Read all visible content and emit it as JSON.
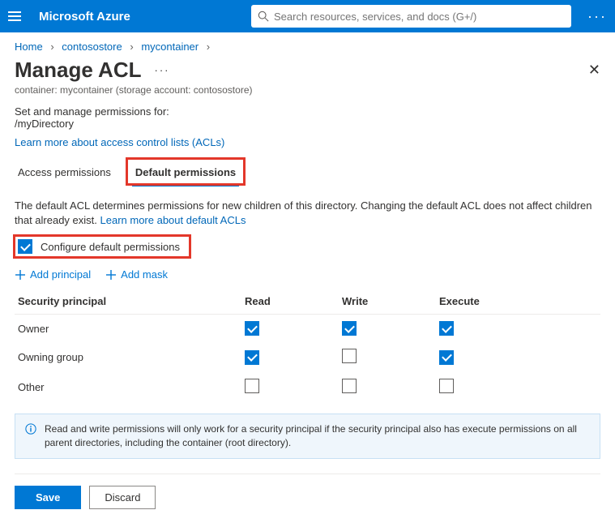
{
  "topbar": {
    "brand": "Microsoft Azure",
    "search_placeholder": "Search resources, services, and docs (G+/)"
  },
  "breadcrumb": {
    "items": [
      "Home",
      "contosostore",
      "mycontainer"
    ]
  },
  "header": {
    "title": "Manage ACL",
    "subtitle": "container: mycontainer (storage account: contosostore)"
  },
  "intro": {
    "label": "Set and manage permissions for:",
    "path": "/myDirectory",
    "learn_link": "Learn more about access control lists (ACLs)"
  },
  "tabs": {
    "access": "Access permissions",
    "default": "Default permissions"
  },
  "description": {
    "text": "The default ACL determines permissions for new children of this directory. Changing the default ACL does not affect children that already exist. ",
    "link": "Learn more about default ACLs"
  },
  "configure": {
    "label": "Configure default permissions",
    "checked": true
  },
  "actions": {
    "add_principal": "Add principal",
    "add_mask": "Add mask"
  },
  "table": {
    "headers": {
      "principal": "Security principal",
      "read": "Read",
      "write": "Write",
      "execute": "Execute"
    },
    "rows": [
      {
        "principal": "Owner",
        "read": true,
        "write": true,
        "execute": true
      },
      {
        "principal": "Owning group",
        "read": true,
        "write": false,
        "execute": true
      },
      {
        "principal": "Other",
        "read": false,
        "write": false,
        "execute": false
      }
    ]
  },
  "info": "Read and write permissions will only work for a security principal if the security principal also has execute permissions on all parent directories, including the container (root directory).",
  "buttons": {
    "save": "Save",
    "discard": "Discard"
  }
}
